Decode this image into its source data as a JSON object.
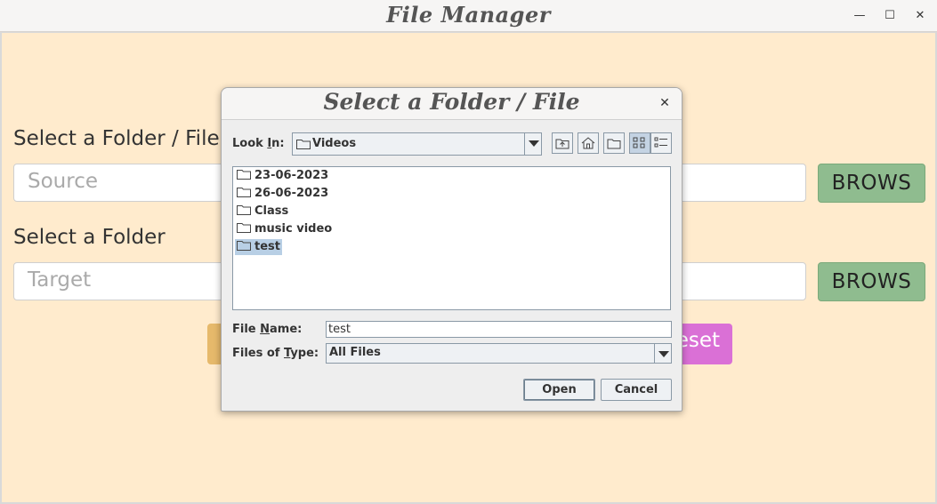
{
  "window": {
    "title": "File Manager",
    "minimize_glyph": "—",
    "maximize_glyph": "☐",
    "close_glyph": "✕"
  },
  "main": {
    "source_label": "Select a Folder / File",
    "source_placeholder": "Source",
    "target_label": "Select a Folder",
    "target_placeholder": "Target",
    "browse_label": "BROWS",
    "reset_label": "Reset",
    "reset_visible_text": "eset"
  },
  "dialog": {
    "title": "Select a Folder / File",
    "look_in_label": "Look In:",
    "look_in_value": "Videos",
    "items": [
      {
        "name": "23-06-2023",
        "selected": false
      },
      {
        "name": "26-06-2023",
        "selected": false
      },
      {
        "name": "Class",
        "selected": false
      },
      {
        "name": "music video",
        "selected": false
      },
      {
        "name": "test",
        "selected": true
      }
    ],
    "file_name_label": "File Name:",
    "file_name_value": "test",
    "files_of_type_label": "Files of Type:",
    "files_of_type_value": "All Files",
    "open_label": "Open",
    "cancel_label": "Cancel"
  },
  "colors": {
    "background": "#ffebcd",
    "browse_button": "#8fbc8f",
    "move_button": "#e6b96b",
    "reset_button": "#da70d6",
    "selection": "#b8cfe5"
  }
}
